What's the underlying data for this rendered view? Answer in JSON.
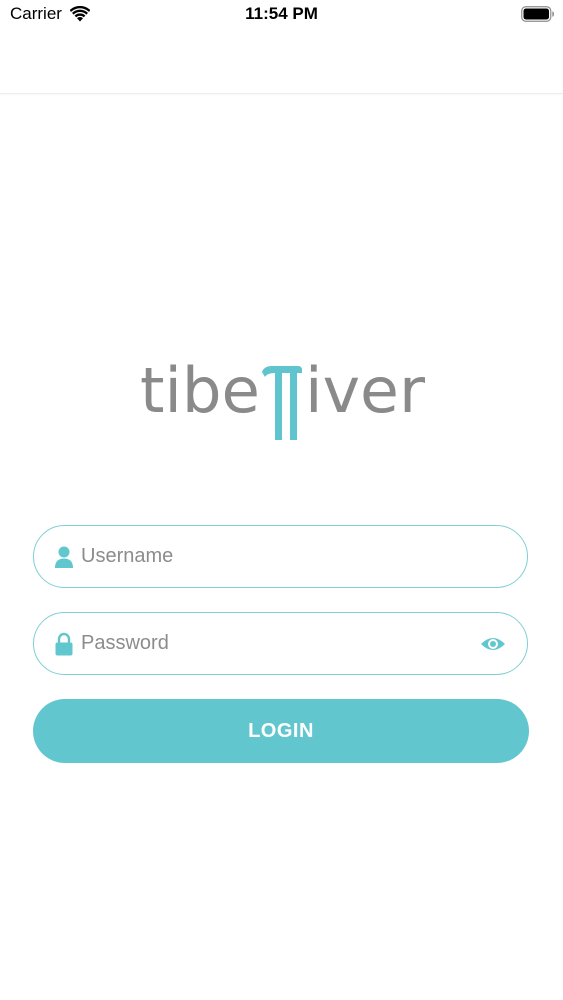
{
  "status_bar": {
    "carrier": "Carrier",
    "time": "11:54 PM",
    "wifi_icon": "wifi-icon",
    "battery_icon": "battery-icon"
  },
  "logo": {
    "text": "tiberriver",
    "text_color": "#8a8a8a",
    "accent_color": "#5fc4cd"
  },
  "login_form": {
    "username": {
      "placeholder": "Username",
      "value": "",
      "icon": "user-icon"
    },
    "password": {
      "placeholder": "Password",
      "value": "",
      "icon": "lock-icon",
      "toggle_icon": "eye-icon"
    },
    "login_label": "LOGIN"
  },
  "colors": {
    "accent": "#62c6cf",
    "field_border": "#7fcfd6",
    "placeholder": "#8c8c8c"
  }
}
